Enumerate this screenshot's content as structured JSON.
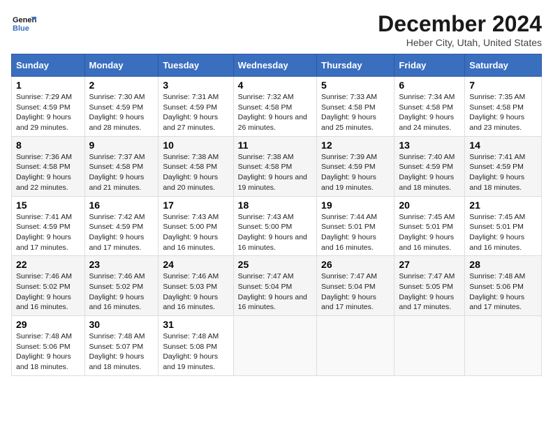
{
  "logo": {
    "line1": "General",
    "line2": "Blue"
  },
  "title": "December 2024",
  "subtitle": "Heber City, Utah, United States",
  "headers": [
    "Sunday",
    "Monday",
    "Tuesday",
    "Wednesday",
    "Thursday",
    "Friday",
    "Saturday"
  ],
  "weeks": [
    [
      {
        "day": "1",
        "sunrise": "7:29 AM",
        "sunset": "4:59 PM",
        "daylight": "9 hours and 29 minutes."
      },
      {
        "day": "2",
        "sunrise": "7:30 AM",
        "sunset": "4:59 PM",
        "daylight": "9 hours and 28 minutes."
      },
      {
        "day": "3",
        "sunrise": "7:31 AM",
        "sunset": "4:59 PM",
        "daylight": "9 hours and 27 minutes."
      },
      {
        "day": "4",
        "sunrise": "7:32 AM",
        "sunset": "4:58 PM",
        "daylight": "9 hours and 26 minutes."
      },
      {
        "day": "5",
        "sunrise": "7:33 AM",
        "sunset": "4:58 PM",
        "daylight": "9 hours and 25 minutes."
      },
      {
        "day": "6",
        "sunrise": "7:34 AM",
        "sunset": "4:58 PM",
        "daylight": "9 hours and 24 minutes."
      },
      {
        "day": "7",
        "sunrise": "7:35 AM",
        "sunset": "4:58 PM",
        "daylight": "9 hours and 23 minutes."
      }
    ],
    [
      {
        "day": "8",
        "sunrise": "7:36 AM",
        "sunset": "4:58 PM",
        "daylight": "9 hours and 22 minutes."
      },
      {
        "day": "9",
        "sunrise": "7:37 AM",
        "sunset": "4:58 PM",
        "daylight": "9 hours and 21 minutes."
      },
      {
        "day": "10",
        "sunrise": "7:38 AM",
        "sunset": "4:58 PM",
        "daylight": "9 hours and 20 minutes."
      },
      {
        "day": "11",
        "sunrise": "7:38 AM",
        "sunset": "4:58 PM",
        "daylight": "9 hours and 19 minutes."
      },
      {
        "day": "12",
        "sunrise": "7:39 AM",
        "sunset": "4:59 PM",
        "daylight": "9 hours and 19 minutes."
      },
      {
        "day": "13",
        "sunrise": "7:40 AM",
        "sunset": "4:59 PM",
        "daylight": "9 hours and 18 minutes."
      },
      {
        "day": "14",
        "sunrise": "7:41 AM",
        "sunset": "4:59 PM",
        "daylight": "9 hours and 18 minutes."
      }
    ],
    [
      {
        "day": "15",
        "sunrise": "7:41 AM",
        "sunset": "4:59 PM",
        "daylight": "9 hours and 17 minutes."
      },
      {
        "day": "16",
        "sunrise": "7:42 AM",
        "sunset": "4:59 PM",
        "daylight": "9 hours and 17 minutes."
      },
      {
        "day": "17",
        "sunrise": "7:43 AM",
        "sunset": "5:00 PM",
        "daylight": "9 hours and 16 minutes."
      },
      {
        "day": "18",
        "sunrise": "7:43 AM",
        "sunset": "5:00 PM",
        "daylight": "9 hours and 16 minutes."
      },
      {
        "day": "19",
        "sunrise": "7:44 AM",
        "sunset": "5:01 PM",
        "daylight": "9 hours and 16 minutes."
      },
      {
        "day": "20",
        "sunrise": "7:45 AM",
        "sunset": "5:01 PM",
        "daylight": "9 hours and 16 minutes."
      },
      {
        "day": "21",
        "sunrise": "7:45 AM",
        "sunset": "5:01 PM",
        "daylight": "9 hours and 16 minutes."
      }
    ],
    [
      {
        "day": "22",
        "sunrise": "7:46 AM",
        "sunset": "5:02 PM",
        "daylight": "9 hours and 16 minutes."
      },
      {
        "day": "23",
        "sunrise": "7:46 AM",
        "sunset": "5:02 PM",
        "daylight": "9 hours and 16 minutes."
      },
      {
        "day": "24",
        "sunrise": "7:46 AM",
        "sunset": "5:03 PM",
        "daylight": "9 hours and 16 minutes."
      },
      {
        "day": "25",
        "sunrise": "7:47 AM",
        "sunset": "5:04 PM",
        "daylight": "9 hours and 16 minutes."
      },
      {
        "day": "26",
        "sunrise": "7:47 AM",
        "sunset": "5:04 PM",
        "daylight": "9 hours and 17 minutes."
      },
      {
        "day": "27",
        "sunrise": "7:47 AM",
        "sunset": "5:05 PM",
        "daylight": "9 hours and 17 minutes."
      },
      {
        "day": "28",
        "sunrise": "7:48 AM",
        "sunset": "5:06 PM",
        "daylight": "9 hours and 17 minutes."
      }
    ],
    [
      {
        "day": "29",
        "sunrise": "7:48 AM",
        "sunset": "5:06 PM",
        "daylight": "9 hours and 18 minutes."
      },
      {
        "day": "30",
        "sunrise": "7:48 AM",
        "sunset": "5:07 PM",
        "daylight": "9 hours and 18 minutes."
      },
      {
        "day": "31",
        "sunrise": "7:48 AM",
        "sunset": "5:08 PM",
        "daylight": "9 hours and 19 minutes."
      },
      null,
      null,
      null,
      null
    ]
  ]
}
